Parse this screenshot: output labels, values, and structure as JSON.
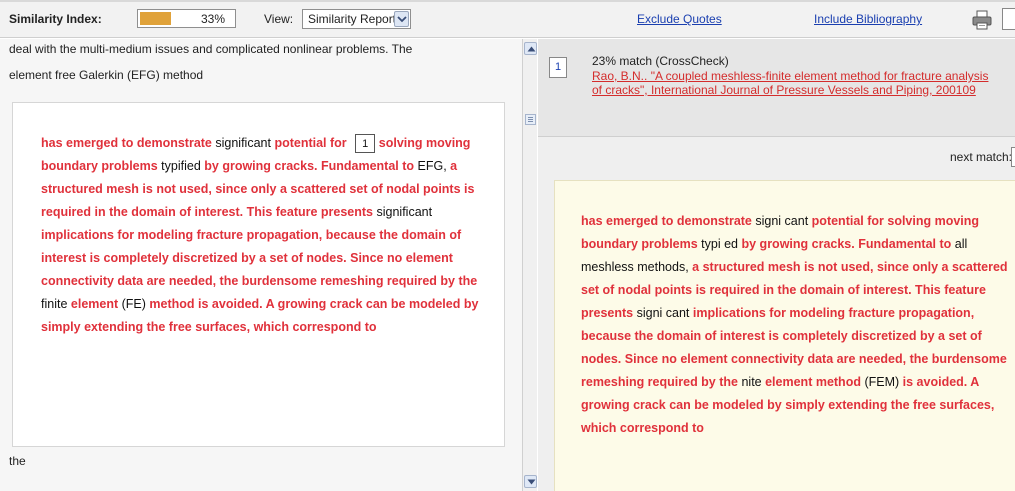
{
  "toolbar": {
    "similarity_label": "Similarity Index:",
    "similarity_value": "33%",
    "similarity_fraction": 0.33,
    "view_label": "View:",
    "view_selected": "Similarity Report",
    "exclude_quotes": "Exclude Quotes",
    "include_bibliography": "Include Bibliography"
  },
  "left": {
    "line1": "deal with the multi-medium issues and complicated nonlinear problems. The",
    "line2": "element free Galerkin (EFG) method",
    "bottom_line": "the",
    "paragraph": [
      {
        "t": "has emerged to demonstrate",
        "s": "match"
      },
      {
        "t": "significant",
        "s": "normal"
      },
      {
        "t": "potential for",
        "s": "match"
      },
      {
        "t": "solving moving boundary problems",
        "s": "match"
      },
      {
        "t": "typified",
        "s": "normal"
      },
      {
        "t": "by growing cracks. Fundamental to",
        "s": "match"
      },
      {
        "t": "EFG,",
        "s": "normal"
      },
      {
        "t": "a structured mesh is not used, since only a scattered set of nodal points is required in the domain of interest. This feature presents",
        "s": "match"
      },
      {
        "t": "significant",
        "s": "normal"
      },
      {
        "t": "implications for modeling fracture propagation, because the domain of interest is completely discretized by a set of nodes. Since no element connectivity data are needed, the burdensome remeshing required by the",
        "s": "match"
      },
      {
        "t": "finite",
        "s": "normal"
      },
      {
        "t": "element",
        "s": "match"
      },
      {
        "t": "(FE)",
        "s": "normal"
      },
      {
        "t": "method is avoided. A growing crack can be modeled by simply extending the free surfaces, which correspond to",
        "s": "match"
      }
    ],
    "marker": "1"
  },
  "right": {
    "match_number": "1",
    "match_title": "23% match (CrossCheck)",
    "match_source": "Rao, B.N.. \"A coupled meshless-finite element method for fracture analysis of cracks\", International Journal of Pressure Vessels and Piping, 200109",
    "next_match_label": "next match:",
    "paragraph": [
      {
        "t": "has emerged to demonstrate",
        "s": "match"
      },
      {
        "t": "signi cant",
        "s": "normal"
      },
      {
        "t": "potential for solving moving boundary problems",
        "s": "match"
      },
      {
        "t": "typi ed",
        "s": "normal"
      },
      {
        "t": "by growing cracks. Fundamental to",
        "s": "match"
      },
      {
        "t": "all meshless methods,",
        "s": "normal"
      },
      {
        "t": "a structured mesh is not used, since only a scattered set of nodal points is required in the domain of interest. This feature presents",
        "s": "match"
      },
      {
        "t": "signi cant",
        "s": "normal"
      },
      {
        "t": "implications for modeling fracture propagation, because the domain of interest is completely discretized by a set of nodes. Since no element connectivity data are needed, the burdensome remeshing required by the",
        "s": "match"
      },
      {
        "t": "nite",
        "s": "normal"
      },
      {
        "t": "element method",
        "s": "match"
      },
      {
        "t": "(FEM)",
        "s": "normal"
      },
      {
        "t": "is avoided. A growing crack can be modeled by simply extending the free surfaces, which correspond to",
        "s": "match"
      }
    ]
  },
  "colors": {
    "match_text": "#e0313b",
    "source_bg": "#fdfbe8",
    "meter_fill": "#e0a23a",
    "link": "#1a3fb0"
  }
}
